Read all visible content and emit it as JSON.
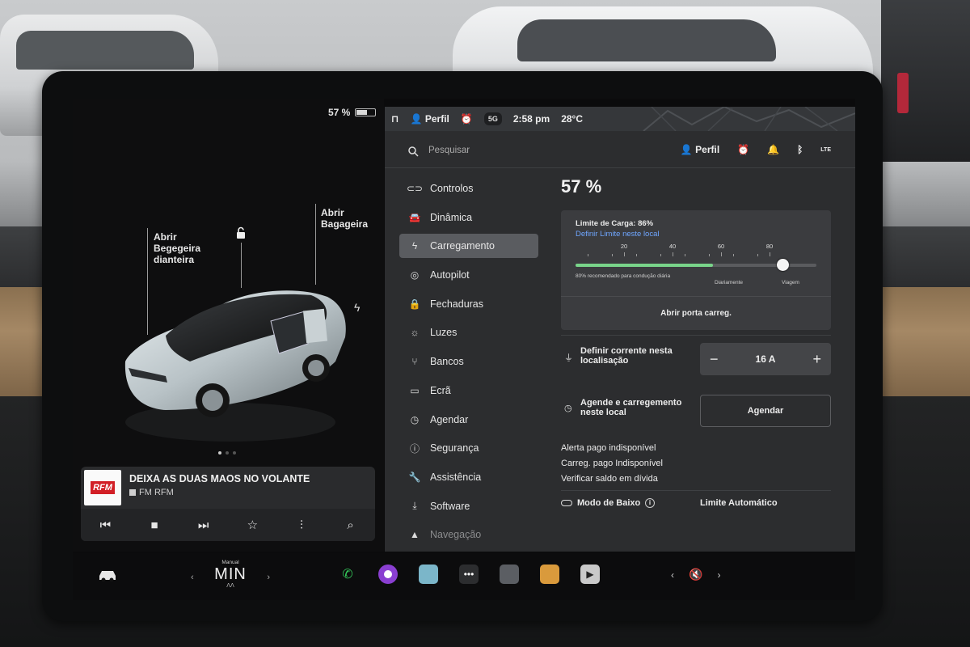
{
  "car_panel": {
    "battery_pct": "57 %",
    "battery_level": 0.57,
    "front_trunk": [
      "Abrir",
      "Begegeira",
      "dianteira"
    ],
    "rear_trunk": [
      "Abrir",
      "Bagageira"
    ],
    "lock_icon": "unlock-icon",
    "charge_icon": "bolt-icon",
    "carousel_active": 0,
    "carousel_count": 3
  },
  "media": {
    "logo_text": "RFM",
    "title": "DEIXA AS DUAS MAOS NO VOLANTE",
    "station": "FM RFM",
    "controls": [
      "previous-icon",
      "stop-icon",
      "next-icon",
      "favorite-icon",
      "equalizer-icon",
      "search-icon"
    ],
    "control_glyphs": [
      "⏮",
      "■",
      "⏭",
      "☆",
      "⫶",
      "⌕"
    ]
  },
  "status_bar": {
    "profile": "Perfil",
    "network": "5G",
    "time": "2:58 pm",
    "temp": "28°C"
  },
  "search": {
    "placeholder": "Pesquisar"
  },
  "top_icons": {
    "profile": "Perfil",
    "lte": "LTE"
  },
  "menu": [
    {
      "label": "Controlos",
      "icon": "toggle-icon",
      "glyph": "⊂⊃"
    },
    {
      "label": "Dinâmica",
      "icon": "car-icon",
      "glyph": "🚘"
    },
    {
      "label": "Carregamento",
      "icon": "bolt-icon",
      "glyph": "ϟ",
      "active": true
    },
    {
      "label": "Autopilot",
      "icon": "steering-wheel-icon",
      "glyph": "◎"
    },
    {
      "label": "Fechaduras",
      "icon": "lock-icon",
      "glyph": "🔒"
    },
    {
      "label": "Luzes",
      "icon": "light-icon",
      "glyph": "☼"
    },
    {
      "label": "Bancos",
      "icon": "seat-icon",
      "glyph": "⑂"
    },
    {
      "label": "Ecrã",
      "icon": "display-icon",
      "glyph": "▭"
    },
    {
      "label": "Agendar",
      "icon": "clock-icon",
      "glyph": "◷"
    },
    {
      "label": "Segurança",
      "icon": "alert-icon",
      "glyph": "ⓘ"
    },
    {
      "label": "Assistência",
      "icon": "wrench-icon",
      "glyph": "🔧"
    },
    {
      "label": "Software",
      "icon": "download-icon",
      "glyph": "⤓"
    },
    {
      "label": "Navegação",
      "icon": "navigation-icon",
      "glyph": "▲"
    }
  ],
  "charging": {
    "battery_pct": "57 %",
    "limit_title": "Limite de Carga: 86%",
    "limit_link": "Definir Limite neste local",
    "limit_value": 86,
    "current_charge": 57,
    "ticks": [
      "20",
      "40",
      "60",
      "80"
    ],
    "tick_values": [
      20,
      40,
      60,
      80
    ],
    "slider_note": "80% recomendado para condução diária",
    "daily_label": "Diariamente",
    "trip_label": "Viagem",
    "open_port": "Abrir porta carreg.",
    "current_label": "Definir corrente nesta localisação",
    "current_value": "16 A",
    "minus": "−",
    "plus": "+",
    "schedule_label": "Agende e carregemento neste local",
    "schedule_button": "Agendar",
    "info": [
      "Alerta pago indisponível",
      "Carreg. pago Indisponível",
      "Verificar saldo em dívida"
    ],
    "low_mode": "Modo de Baixo",
    "auto_limit": "Limite Automático"
  },
  "dock": {
    "climate_mode": "Manual",
    "climate_value": "MIN",
    "left_arrow": "‹",
    "right_arrow": "›",
    "volume_icon": "mute-icon"
  }
}
